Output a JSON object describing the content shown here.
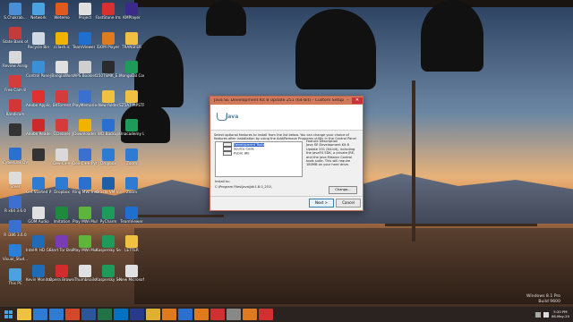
{
  "desktop_icons": [
    {
      "label": "S.Chakrab...",
      "color": "#4a8fd6"
    },
    {
      "label": "State Bank of India",
      "color": "#c43b3b"
    },
    {
      "label": "Review Assignmen...",
      "color": "#d9d9d9"
    },
    {
      "label": "Free Cam 8",
      "color": "#d43b3b"
    },
    {
      "label": "Bandicam",
      "color": "#d23636"
    },
    {
      "label": "",
      "color": "#333"
    },
    {
      "label": "CyberLink DVD Suite",
      "color": "#2b6fd0"
    },
    {
      "label": "Steer",
      "color": "#ddd"
    },
    {
      "label": "R x64 3.6.0",
      "color": "#3b6fd0"
    },
    {
      "label": "R i386 3.6.0",
      "color": "#3b6fd0"
    },
    {
      "label": "Visual_Stud... Code",
      "color": "#2b7fd9"
    },
    {
      "label": "This PC",
      "color": "#4aa3df"
    },
    {
      "label": "Network",
      "color": "#4aa3df"
    },
    {
      "label": "Recycle Bin",
      "color": "#cfd9e3"
    },
    {
      "label": "Control Panel",
      "color": "#3b8fd6"
    },
    {
      "label": "Adobe Application...",
      "color": "#e03030"
    },
    {
      "label": "Adobe Reader 9",
      "color": "#cc2a2a"
    },
    {
      "label": "",
      "color": "#333"
    },
    {
      "label": "Get Started With OneD...",
      "color": "#2d7bd3"
    },
    {
      "label": "GOM Audio",
      "color": "#e0e0e0"
    },
    {
      "label": "Intel® HD Graphics C...",
      "color": "#1f6bb5"
    },
    {
      "label": "Kevin Monitor",
      "color": "#1f6bb5"
    },
    {
      "label": "Wetemo",
      "color": "#e05a1e"
    },
    {
      "label": "cclash.ic",
      "color": "#f0b400"
    },
    {
      "label": "_BanglaWord",
      "color": "#e0e0e0"
    },
    {
      "label": "BitTorrent",
      "color": "#d53b3b"
    },
    {
      "label": "CCleaner",
      "color": "#d53b3b"
    },
    {
      "label": "Dev-C++",
      "color": "#d9d9d9"
    },
    {
      "label": "Dropbox",
      "color": "#2d7bd3"
    },
    {
      "label": "Imitation",
      "color": "#1e8a3c"
    },
    {
      "label": "Start Tor Browser",
      "color": "#7a3cb5"
    },
    {
      "label": "Opera Browser",
      "color": "#d12b2b"
    },
    {
      "label": "Project",
      "color": "#e0e0e0"
    },
    {
      "label": "TeamViewer 13",
      "color": "#1e6fd0"
    },
    {
      "label": "APS Booklet",
      "color": "#cfcfcf"
    },
    {
      "label": "PlayMemories Home",
      "color": "#3b6fd0"
    },
    {
      "label": "JDownloader 2",
      "color": "#f0b400"
    },
    {
      "label": "Dev-C++ Python",
      "color": "#3b6fd0"
    },
    {
      "label": "Ring MWi Instructor",
      "color": "#2b6fd0"
    },
    {
      "label": "Play MWi Multiplayer",
      "color": "#5fb53b"
    },
    {
      "label": "Play MWi Multiplayer",
      "color": "#5fb53b"
    },
    {
      "label": "Thumbnails",
      "color": "#e0e0e0"
    },
    {
      "label": "FastStone Image Viewer",
      "color": "#d63030"
    },
    {
      "label": "GOM Player",
      "color": "#e07a1e"
    },
    {
      "label": "150TSMK_E...",
      "color": "#2b2b2b"
    },
    {
      "label": "New folder",
      "color": "#f0c040"
    },
    {
      "label": "WD Backup",
      "color": "#2b6fd0"
    },
    {
      "label": "Dropbox",
      "color": "#2d7bd3"
    },
    {
      "label": "Oracle VM VirtualBox",
      "color": "#1e5fa8"
    },
    {
      "label": "PyCharm",
      "color": "#1e9a5a"
    },
    {
      "label": "Kaspersky Secure C...",
      "color": "#1e9a5a"
    },
    {
      "label": "Kaspersky Secure C...",
      "color": "#1e9a5a"
    },
    {
      "label": "KMPlayer",
      "color": "#3b2a8a"
    },
    {
      "label": "TRANSFER",
      "color": "#f0c040"
    },
    {
      "label": "MongoDB Compass",
      "color": "#1e9a5a"
    },
    {
      "label": "SZ5A7 MPSTP",
      "color": "#f0c040"
    },
    {
      "label": "Unacademy Learning...",
      "color": "#1e9a5a"
    },
    {
      "label": "Zoom",
      "color": "#2d7bd3"
    },
    {
      "label": "Zoom",
      "color": "#2d7bd3"
    },
    {
      "label": "TeamViewer",
      "color": "#1e6fd0"
    },
    {
      "label": "LETTER",
      "color": "#f0c040"
    },
    {
      "label": "New Microsoft...",
      "color": "#e0e0e0"
    }
  ],
  "dialog": {
    "title": "Java SE Development Kit 8 Update 251 (64-bit) - Custom Setup",
    "minimize": "–",
    "close": "✕",
    "brand": "Java",
    "instructions": "Select optional features to install from the list below. You can change your choice of features after installation by using the Add/Remove Programs utility in the Control Panel",
    "features": [
      {
        "label": "Development Tools",
        "selected": true
      },
      {
        "label": "Source Code",
        "selected": false
      },
      {
        "label": "Public JRE",
        "selected": false
      }
    ],
    "feature_desc_title": "Feature Description",
    "feature_desc": "Java SE Development Kit 8 Update 251 (64-bit), including the JavaFX SDK, a private JRE, and the Java Mission Control tools suite. This will require 180MB on your hard drive.",
    "install_to_label": "Install to:",
    "install_path": "C:\\Program Files\\Java\\jdk1.8.0_251\\",
    "change_button": "Change...",
    "next_button": "Next >",
    "cancel_button": "Cancel"
  },
  "taskbar_apps": [
    {
      "name": "file-explorer",
      "color": "#f0c040"
    },
    {
      "name": "edge",
      "color": "#2d7bd3"
    },
    {
      "name": "store",
      "color": "#2d7bd3"
    },
    {
      "name": "powerpoint",
      "color": "#d04a2a"
    },
    {
      "name": "word",
      "color": "#2b579a"
    },
    {
      "name": "excel",
      "color": "#217346"
    },
    {
      "name": "outlook",
      "color": "#0072c6"
    },
    {
      "name": "photoshop",
      "color": "#2a3a8a"
    },
    {
      "name": "chrome",
      "color": "#e0b030"
    },
    {
      "name": "firefox",
      "color": "#e07a1e"
    },
    {
      "name": "app-blue",
      "color": "#2b6fd0"
    },
    {
      "name": "app-orange",
      "color": "#e07a1e"
    },
    {
      "name": "app-red",
      "color": "#d03030"
    },
    {
      "name": "app-gray",
      "color": "#888"
    },
    {
      "name": "vlc",
      "color": "#e07a1e"
    },
    {
      "name": "java",
      "color": "#d03030"
    }
  ],
  "watermark": {
    "line1": "Windows 8.1 Pro",
    "line2": "Build 9600"
  },
  "clock": {
    "time": "5:20 PM",
    "date": "08-May-20"
  }
}
